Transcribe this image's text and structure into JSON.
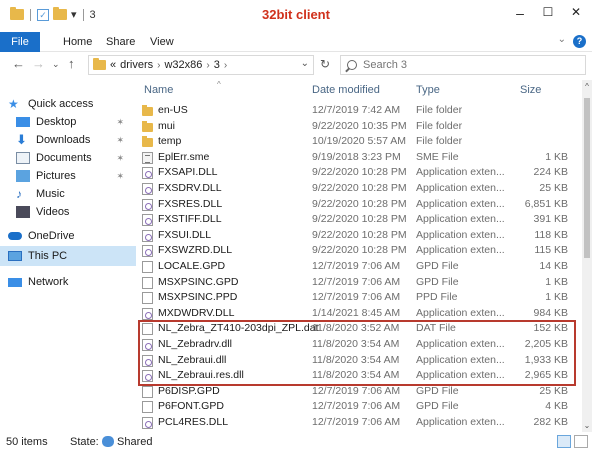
{
  "window": {
    "title": "32bit client",
    "qat_number": "3",
    "minimize": "–",
    "maximize": "☐",
    "close": "✕"
  },
  "ribbon": {
    "tabs": [
      "File",
      "Home",
      "Share",
      "View"
    ],
    "help": "?"
  },
  "address": {
    "prefix": "«",
    "crumbs": [
      "drivers",
      "w32x86",
      "3"
    ],
    "search_placeholder": "Search 3"
  },
  "nav": {
    "quick_access": "Quick access",
    "items": [
      "Desktop",
      "Downloads",
      "Documents",
      "Pictures",
      "Music",
      "Videos"
    ],
    "onedrive": "OneDrive",
    "thispc": "This PC",
    "network": "Network"
  },
  "columns": {
    "name": "Name",
    "date": "Date modified",
    "type": "Type",
    "size": "Size"
  },
  "files": [
    {
      "name": "en-US",
      "date": "12/7/2019 7:42 AM",
      "type": "File folder",
      "size": "",
      "icon": "folder"
    },
    {
      "name": "mui",
      "date": "9/22/2020 10:35 PM",
      "type": "File folder",
      "size": "",
      "icon": "folder"
    },
    {
      "name": "temp",
      "date": "10/19/2020 5:57 AM",
      "type": "File folder",
      "size": "",
      "icon": "folder"
    },
    {
      "name": "EplErr.sme",
      "date": "9/19/2018 3:23 PM",
      "type": "SME File",
      "size": "1 KB",
      "icon": "sme"
    },
    {
      "name": "FXSAPI.DLL",
      "date": "9/22/2020 10:28 PM",
      "type": "Application exten...",
      "size": "224 KB",
      "icon": "dll"
    },
    {
      "name": "FXSDRV.DLL",
      "date": "9/22/2020 10:28 PM",
      "type": "Application exten...",
      "size": "25 KB",
      "icon": "dll"
    },
    {
      "name": "FXSRES.DLL",
      "date": "9/22/2020 10:28 PM",
      "type": "Application exten...",
      "size": "6,851 KB",
      "icon": "dll"
    },
    {
      "name": "FXSTIFF.DLL",
      "date": "9/22/2020 10:28 PM",
      "type": "Application exten...",
      "size": "391 KB",
      "icon": "dll"
    },
    {
      "name": "FXSUI.DLL",
      "date": "9/22/2020 10:28 PM",
      "type": "Application exten...",
      "size": "118 KB",
      "icon": "dll"
    },
    {
      "name": "FXSWZRD.DLL",
      "date": "9/22/2020 10:28 PM",
      "type": "Application exten...",
      "size": "115 KB",
      "icon": "dll"
    },
    {
      "name": "LOCALE.GPD",
      "date": "12/7/2019 7:06 AM",
      "type": "GPD File",
      "size": "14 KB",
      "icon": "doc"
    },
    {
      "name": "MSXPSINC.GPD",
      "date": "12/7/2019 7:06 AM",
      "type": "GPD File",
      "size": "1 KB",
      "icon": "doc"
    },
    {
      "name": "MSXPSINC.PPD",
      "date": "12/7/2019 7:06 AM",
      "type": "PPD File",
      "size": "1 KB",
      "icon": "doc"
    },
    {
      "name": "MXDWDRV.DLL",
      "date": "1/14/2021 8:45 AM",
      "type": "Application exten...",
      "size": "984 KB",
      "icon": "dll"
    },
    {
      "name": "NL_Zebra_ZT410-203dpi_ZPL.dat",
      "date": "11/8/2020 3:52 AM",
      "type": "DAT File",
      "size": "152 KB",
      "icon": "doc"
    },
    {
      "name": "NL_Zebradrv.dll",
      "date": "11/8/2020 3:54 AM",
      "type": "Application exten...",
      "size": "2,205 KB",
      "icon": "dll"
    },
    {
      "name": "NL_Zebraui.dll",
      "date": "11/8/2020 3:54 AM",
      "type": "Application exten...",
      "size": "1,933 KB",
      "icon": "dll"
    },
    {
      "name": "NL_Zebraui.res.dll",
      "date": "11/8/2020 3:54 AM",
      "type": "Application exten...",
      "size": "2,965 KB",
      "icon": "dll"
    },
    {
      "name": "P6DISP.GPD",
      "date": "12/7/2019 7:06 AM",
      "type": "GPD File",
      "size": "25 KB",
      "icon": "doc"
    },
    {
      "name": "P6FONT.GPD",
      "date": "12/7/2019 7:06 AM",
      "type": "GPD File",
      "size": "4 KB",
      "icon": "doc"
    },
    {
      "name": "PCL4RES.DLL",
      "date": "12/7/2019 7:06 AM",
      "type": "Application exten...",
      "size": "282 KB",
      "icon": "dll"
    }
  ],
  "status": {
    "count": "50 items",
    "state_label": "State:",
    "state_value": "Shared"
  },
  "colors": {
    "accent": "#1a6fc9",
    "title": "#d0301b",
    "highlight_border": "#b83a2e",
    "nav_selected": "#cce4f7"
  }
}
